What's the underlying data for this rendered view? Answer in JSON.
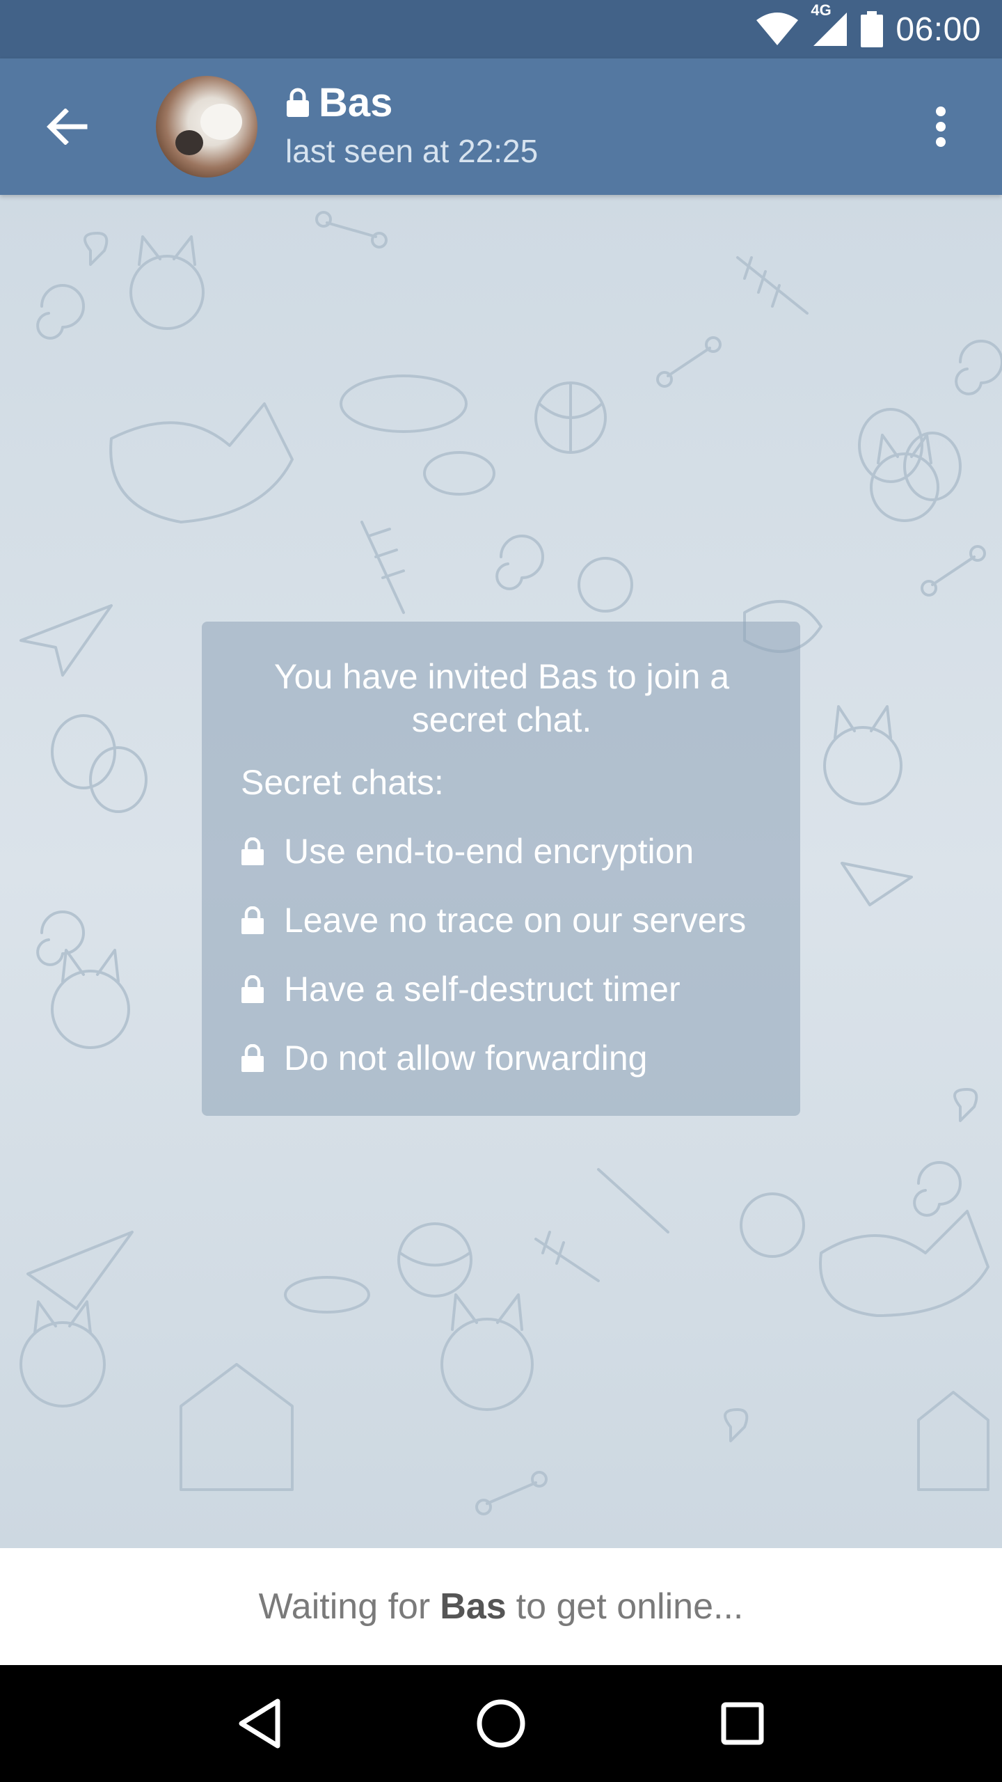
{
  "status_bar": {
    "network_type": "4G",
    "time": "06:00",
    "icons": [
      "wifi-icon",
      "signal-icon",
      "battery-icon"
    ]
  },
  "header": {
    "contact_name": "Bas",
    "last_seen": "last seen at 22:25",
    "icons": [
      "back-arrow-icon",
      "lock-icon",
      "more-vert-icon"
    ]
  },
  "secret_info": {
    "intro": "You have invited Bas to join a secret chat.",
    "heading": "Secret chats:",
    "features": [
      "Use end-to-end encryption",
      "Leave no trace on our servers",
      "Have a self-destruct timer",
      "Do not allow forwarding"
    ]
  },
  "waiting": {
    "prefix": "Waiting for",
    "name": "Bas",
    "suffix": "to get online..."
  },
  "nav_bar": {
    "icons": [
      "back-triangle-icon",
      "home-circle-icon",
      "recents-square-icon"
    ]
  },
  "colors": {
    "status_bar": "#426288",
    "action_bar": "#5478a1",
    "card": "#8fa4b8",
    "chat_background": "#d6e0e8"
  }
}
